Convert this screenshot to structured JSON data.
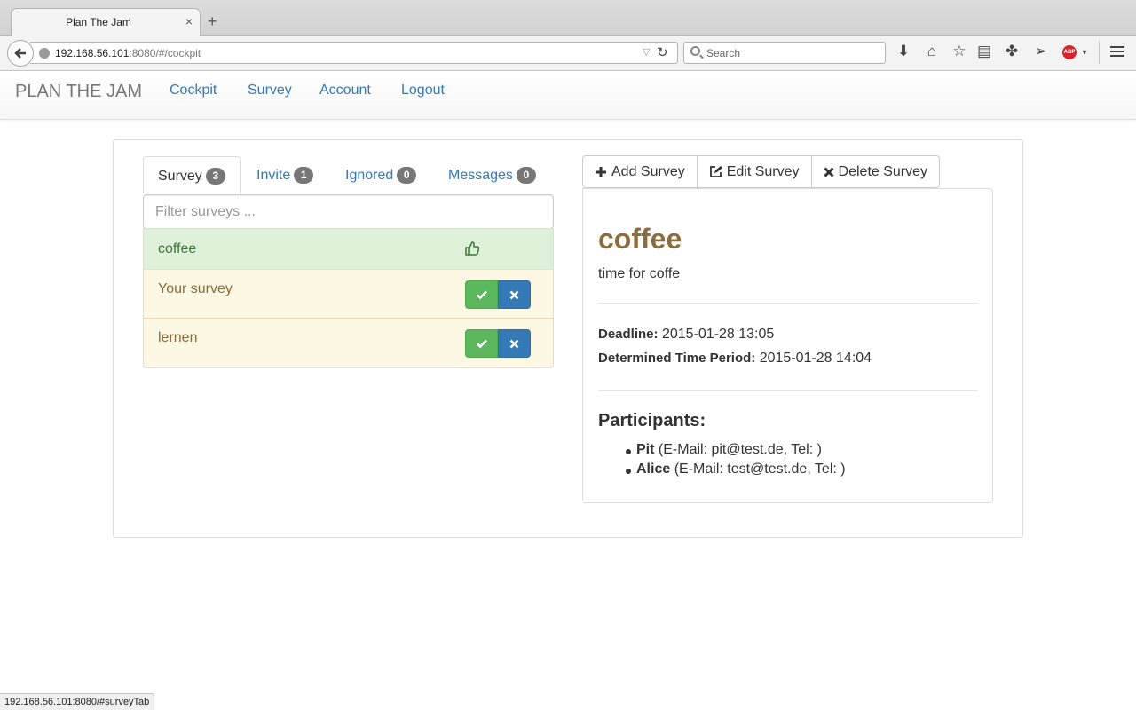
{
  "browser": {
    "tab_title": "Plan The Jam",
    "tab_close": "×",
    "new_tab": "+",
    "url_host": "192.168.56.101",
    "url_rest": ":8080/#/cockpit",
    "search_placeholder": "Search",
    "adblock_label": "ABP",
    "status_url": "192.168.56.101:8080/#surveyTab"
  },
  "navbar": {
    "brand": "PLAN THE JAM",
    "links": [
      "Cockpit",
      "Survey",
      "Account",
      "Logout"
    ]
  },
  "tabs": [
    {
      "label": "Survey",
      "count": "3",
      "active": true
    },
    {
      "label": "Invite",
      "count": "1",
      "active": false
    },
    {
      "label": "Ignored",
      "count": "0",
      "active": false
    },
    {
      "label": "Messages",
      "count": "0",
      "active": false
    }
  ],
  "filter": {
    "placeholder": "Filter surveys ..."
  },
  "surveys": [
    {
      "name": "coffee",
      "state": "accepted"
    },
    {
      "name": "Your survey",
      "state": "pending"
    },
    {
      "name": "lernen",
      "state": "pending"
    }
  ],
  "actions": {
    "add": "Add Survey",
    "edit": "Edit Survey",
    "delete": "Delete Survey"
  },
  "detail": {
    "title": "coffee",
    "description": "time for coffe",
    "deadline_label": "Deadline:",
    "deadline_value": "2015-01-28 13:05",
    "period_label": "Determined Time Period:",
    "period_value": "2015-01-28 14:04",
    "participants_title": "Participants:",
    "participants": [
      {
        "name": "Pit",
        "info": "(E-Mail: pit@test.de, Tel: )"
      },
      {
        "name": "Alice",
        "info": "(E-Mail: test@test.de, Tel: )"
      }
    ]
  },
  "colors": {
    "link": "#337ab7",
    "success_bg": "#dff0d8",
    "warning_bg": "#fcf8e3",
    "accept_button": "#5cb85c",
    "decline_button": "#337ab7",
    "title_brown": "#8a6d3b"
  }
}
